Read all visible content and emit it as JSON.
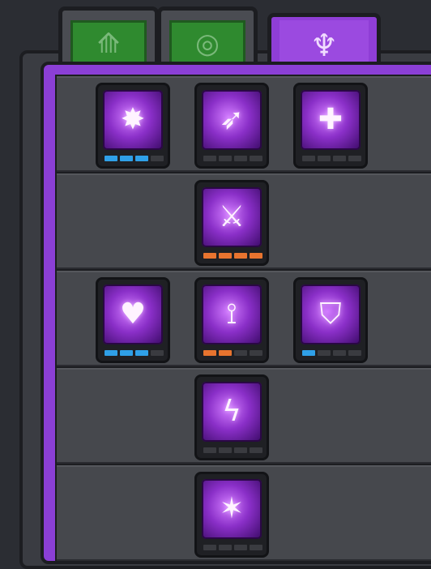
{
  "tabs": [
    {
      "name": "archery",
      "icon": "bow-icon",
      "glyph": "⟰",
      "active": false
    },
    {
      "name": "spiral",
      "icon": "spiral-icon",
      "glyph": "◎",
      "active": false
    },
    {
      "name": "arcane",
      "icon": "crest-icon",
      "glyph": "♆",
      "active": true
    }
  ],
  "colors": {
    "panel": "#8b3fd6",
    "pip_blue": "#2fa0e8",
    "pip_orange": "#e8742f",
    "pip_empty": "#3a3b40"
  },
  "rows": [
    {
      "skills": [
        {
          "icon": "burst-flames-icon",
          "glyph": "✸",
          "level": 3,
          "max": 4,
          "pip_color": "blue"
        },
        {
          "icon": "dash-strike-icon",
          "glyph": "➶",
          "level": 0,
          "max": 4,
          "pip_color": "blue"
        },
        {
          "icon": "heal-cross-icon",
          "glyph": "✚",
          "level": 0,
          "max": 4,
          "pip_color": "blue"
        }
      ]
    },
    {
      "skills": [
        {
          "icon": "twin-swords-icon",
          "glyph": "⚔",
          "level": 4,
          "max": 4,
          "pip_color": "orange"
        }
      ]
    },
    {
      "skills": [
        {
          "icon": "pet-heart-icon",
          "glyph": "♥",
          "level": 3,
          "max": 4,
          "pip_color": "blue"
        },
        {
          "icon": "sword-pillar-icon",
          "glyph": "⟟",
          "level": 2,
          "max": 4,
          "pip_color": "orange"
        },
        {
          "icon": "shield-up-icon",
          "glyph": "⛉",
          "level": 1,
          "max": 4,
          "pip_color": "blue"
        }
      ]
    },
    {
      "skills": [
        {
          "icon": "lightning-arrow-icon",
          "glyph": "ϟ",
          "level": 0,
          "max": 4,
          "pip_color": "blue"
        }
      ]
    },
    {
      "skills": [
        {
          "icon": "sword-storm-icon",
          "glyph": "✶",
          "level": 0,
          "max": 4,
          "pip_color": "blue"
        }
      ]
    }
  ]
}
